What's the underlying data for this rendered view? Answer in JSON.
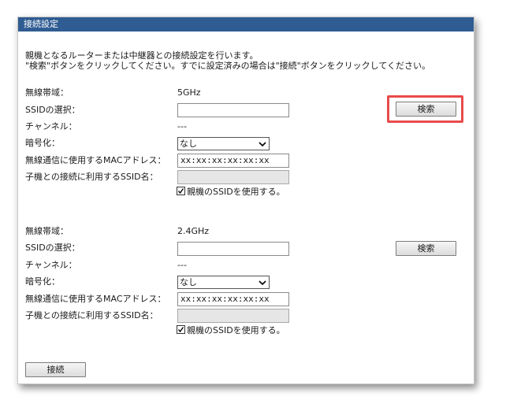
{
  "panel": {
    "title": "接続設定",
    "description_line1": "親機となるルーターまたは中継器との接続設定を行います。",
    "description_line2": "\"検索\"ボタンをクリックしてください。すでに設定済みの場合は\"接続\"ボタンをクリックしてください。"
  },
  "sections": [
    {
      "band_label": "無線帯域：",
      "band_value": "5GHz",
      "ssid_label": "SSIDの選択：",
      "ssid_value": "",
      "search_button": "検索",
      "channel_label": "チャンネル：",
      "channel_value": "---",
      "encryption_label": "暗号化：",
      "encryption_value": "なし",
      "mac_label": "無線通信に使用するMACアドレス：",
      "mac_value": "xx:xx:xx:xx:xx:xx",
      "child_ssid_label": "子機との接続に利用するSSID名：",
      "child_ssid_value": "",
      "use_parent_ssid_label": "親機のSSIDを使用する。",
      "use_parent_ssid_checked": true
    },
    {
      "band_label": "無線帯域：",
      "band_value": "2.4GHz",
      "ssid_label": "SSIDの選択：",
      "ssid_value": "",
      "search_button": "検索",
      "channel_label": "チャンネル：",
      "channel_value": "---",
      "encryption_label": "暗号化：",
      "encryption_value": "なし",
      "mac_label": "無線通信に使用するMACアドレス：",
      "mac_value": "xx:xx:xx:xx:xx:xx",
      "child_ssid_label": "子機との接続に利用するSSID名：",
      "child_ssid_value": "",
      "use_parent_ssid_label": "親機のSSIDを使用する。",
      "use_parent_ssid_checked": true
    }
  ],
  "connect_button": "接続",
  "colors": {
    "titlebar": "#2f5c92",
    "highlight": "#e94b4b"
  },
  "icons": {
    "select_arrow": "chevron-down-icon",
    "checkbox_mark": "checkmark-icon"
  }
}
